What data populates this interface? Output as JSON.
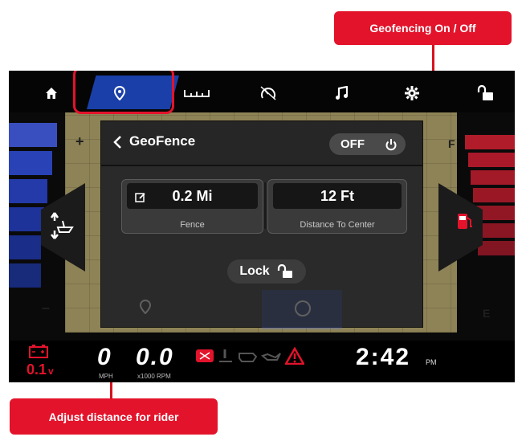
{
  "callouts": {
    "geofencing": "Geofencing On / Off",
    "adjust": "Adjust distance for rider"
  },
  "tabs": [
    {
      "icon": "home-icon"
    },
    {
      "icon": "location-pin-icon"
    },
    {
      "icon": "ruler-icon"
    },
    {
      "icon": "speedometer-icon"
    },
    {
      "icon": "music-note-icon"
    },
    {
      "icon": "gear-icon"
    },
    {
      "icon": "unlock-icon"
    }
  ],
  "gauge": {
    "plus": "+",
    "minus": "–",
    "full": "F",
    "empty": "E"
  },
  "geofence": {
    "title": "GeoFence",
    "toggle_label": "OFF",
    "fence_value": "0.2 Mi",
    "fence_label": "Fence",
    "distance_value": "12 Ft",
    "distance_label": "Distance To Center",
    "lock_label": "Lock"
  },
  "status": {
    "voltage": "0.1",
    "voltage_unit": "v",
    "speed_digit": "0",
    "speed_unit": "MPH",
    "rpm": "0.0",
    "rpm_unit": "x1000 RPM",
    "time": "2:42",
    "ampm": "PM"
  },
  "colors": {
    "accent": "#e3132b",
    "active_tab": "#1a3fa8"
  }
}
